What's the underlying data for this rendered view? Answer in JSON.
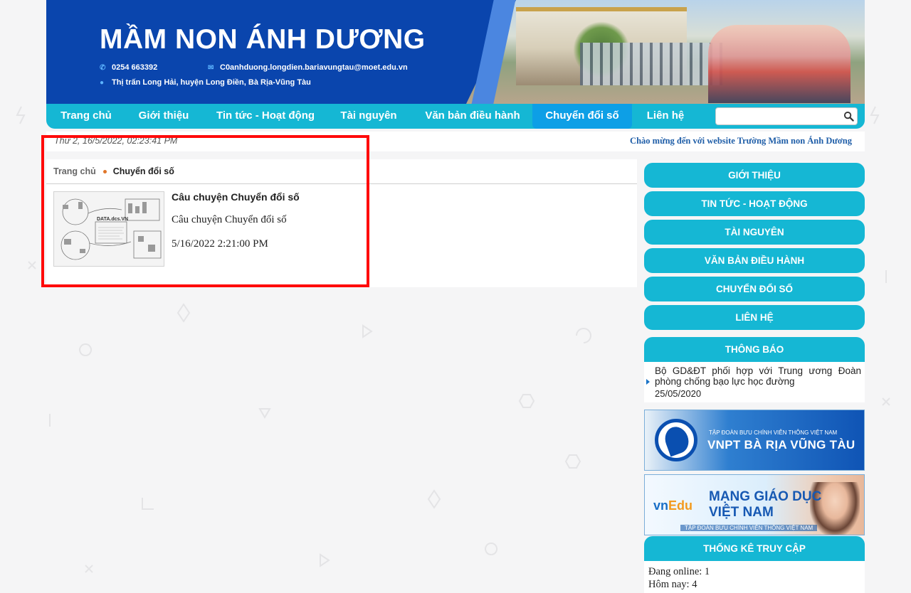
{
  "header": {
    "site_title": "MẦM NON ÁNH DƯƠNG",
    "phone": "0254 663392",
    "email": "C0anhduong.longdien.bariavungtau@moet.edu.vn",
    "address": "Thị trấn Long Hải, huyện Long Điền, Bà Rịa-Vũng Tàu"
  },
  "nav": {
    "items": [
      {
        "label": "Trang chủ"
      },
      {
        "label": "Giới thiệu"
      },
      {
        "label": "Tin tức - Hoạt động"
      },
      {
        "label": "Tài nguyên"
      },
      {
        "label": "Văn bản điều hành"
      },
      {
        "label": "Chuyển đổi số"
      },
      {
        "label": "Liên hệ"
      }
    ],
    "active_index": 5,
    "search_value": ""
  },
  "date_bar": {
    "date_text": "Thứ 2, 16/5/2022, 02:23:41 PM",
    "welcome": "Chào mừng đến với website Trường Mầm non Ánh Dương"
  },
  "breadcrumb": {
    "home": "Trang chủ",
    "current": "Chuyển đổi số"
  },
  "article": {
    "title": "Câu chuyện Chuyển đổi số",
    "summary": "Câu chuyện Chuyển đổi số",
    "date": "5/16/2022 2:21:00 PM",
    "thumb_label": "DATA.dcs.VN"
  },
  "sidebar": {
    "menu": [
      {
        "label": "GIỚI THIỆU"
      },
      {
        "label": "TIN TỨC - HOẠT ĐỘNG"
      },
      {
        "label": "TÀI NGUYÊN"
      },
      {
        "label": "VĂN BẢN ĐIỀU HÀNH"
      },
      {
        "label": "CHUYỂN ĐỔI SỐ"
      },
      {
        "label": "LIÊN HỆ"
      }
    ],
    "notice": {
      "heading": "THÔNG BÁO",
      "title": "Bộ GD&ĐT phối hợp với Trung ương Đoàn phòng chống bạo lực học đường",
      "date": "25/05/2020"
    },
    "banner_vnpt": {
      "sub": "TẬP ĐOÀN BƯU CHÍNH VIỄN THÔNG VIỆT NAM",
      "main": "VNPT BÀ RỊA VŨNG TÀU"
    },
    "banner_vnedu": {
      "logo_vn": "vn",
      "logo_edu": "Edu",
      "main_line1": "MẠNG GIÁO DỤC",
      "main_line2": "VIỆT NAM",
      "sub": "TẬP ĐOÀN BƯU CHÍNH VIỄN THÔNG VIỆT NAM"
    },
    "stats": {
      "heading": "THỐNG KÊ TRUY CẬP",
      "online": "Đang online: 1",
      "today": "Hôm nay: 4"
    }
  },
  "colors": {
    "header_blue": "#0a45ad",
    "nav_cyan": "#15b7d4",
    "nav_active": "#0d9fe6",
    "highlight_red": "#ff0a0a",
    "breadcrumb_dot": "#e0762a"
  }
}
